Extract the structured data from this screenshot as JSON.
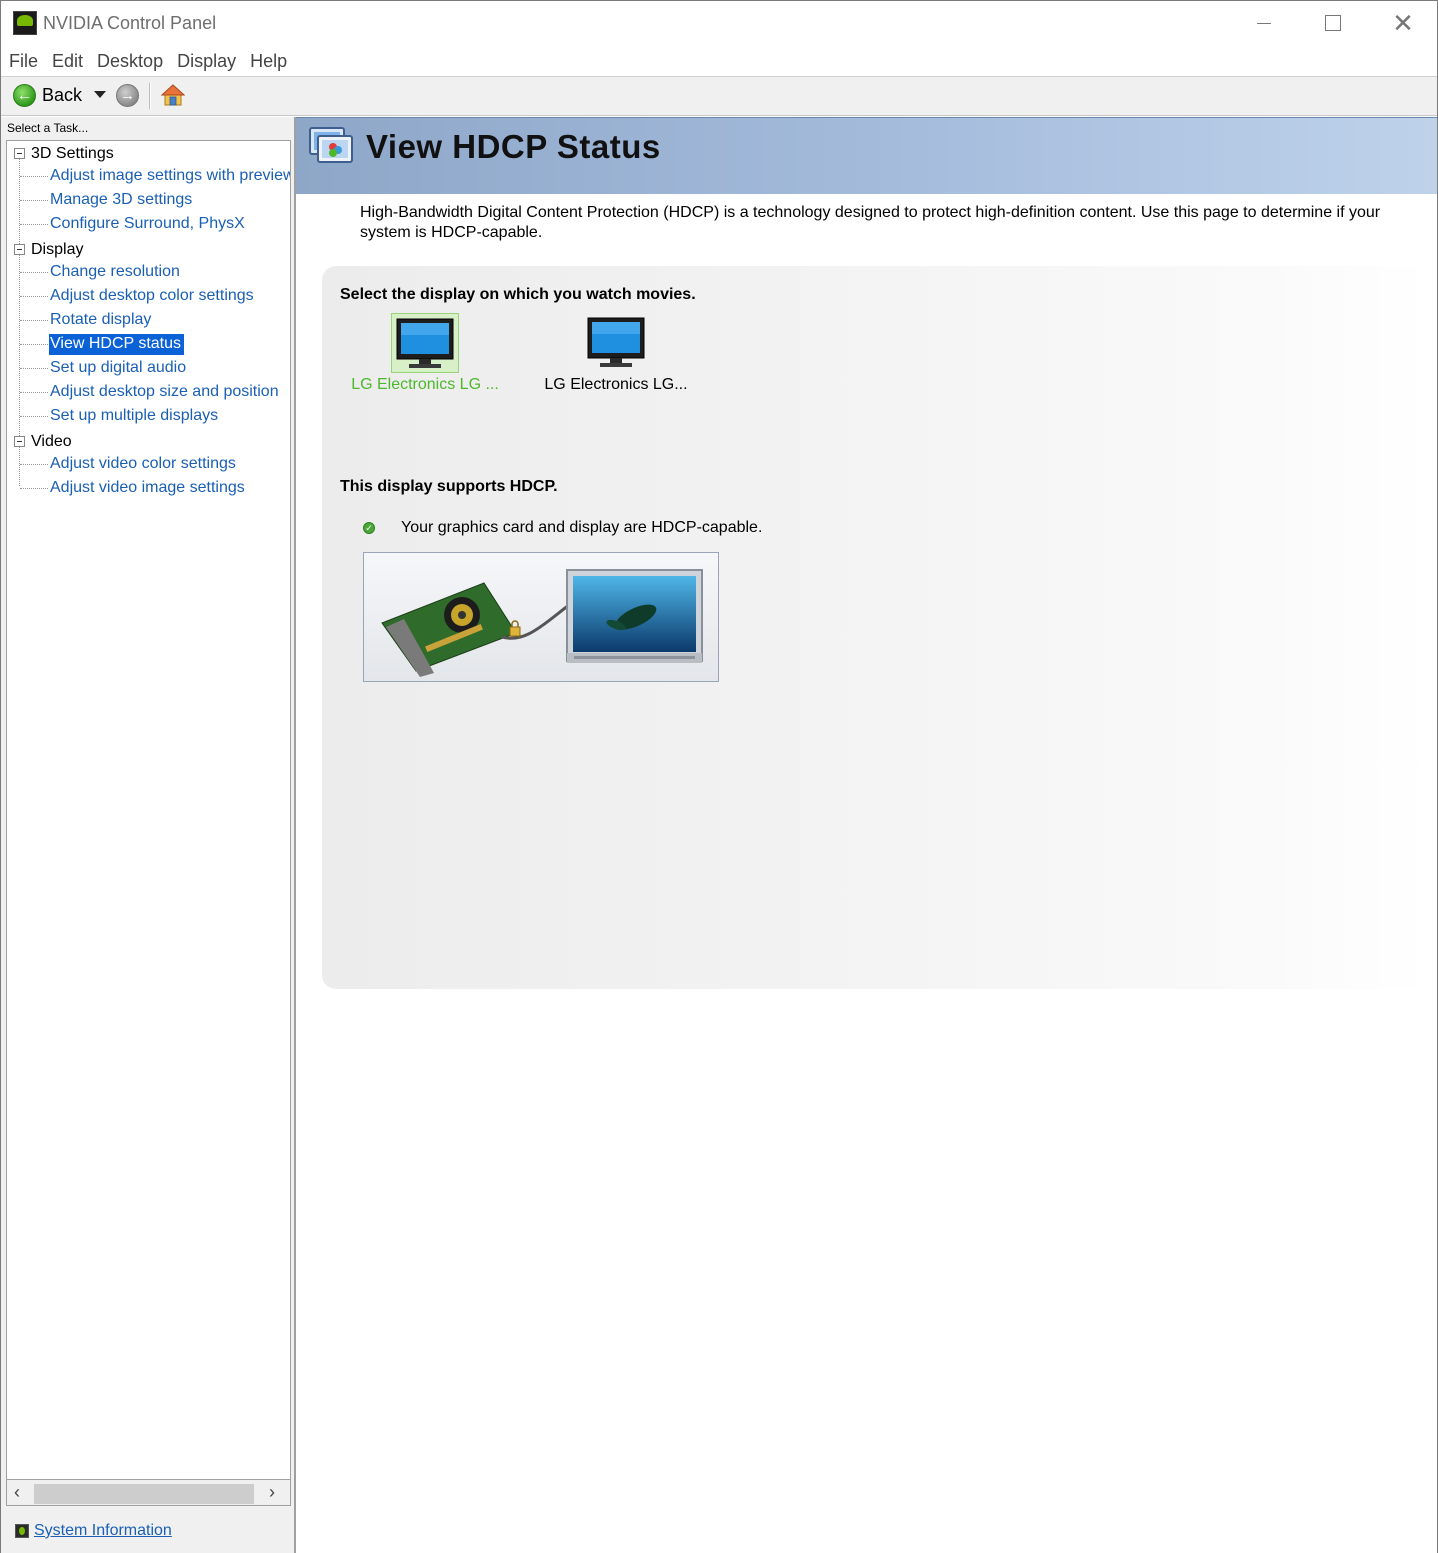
{
  "window": {
    "title": "NVIDIA Control Panel",
    "minimize_icon": "minimize-icon",
    "maximize_icon": "maximize-icon",
    "close_icon": "close-icon"
  },
  "menu": [
    "File",
    "Edit",
    "Desktop",
    "Display",
    "Help"
  ],
  "toolbar": {
    "back_label": "Back",
    "icons": [
      "back-arrow-icon",
      "dropdown-icon",
      "forward-arrow-icon",
      "home-icon"
    ]
  },
  "sidebar": {
    "select_task_label": "Select a Task...",
    "groups": [
      {
        "label": "3D Settings",
        "items": [
          "Adjust image settings with preview",
          "Manage 3D settings",
          "Configure Surround, PhysX"
        ]
      },
      {
        "label": "Display",
        "items": [
          "Change resolution",
          "Adjust desktop color settings",
          "Rotate display",
          "View HDCP status",
          "Set up digital audio",
          "Adjust desktop size and position",
          "Set up multiple displays"
        ]
      },
      {
        "label": "Video",
        "items": [
          "Adjust video color settings",
          "Adjust video image settings"
        ]
      }
    ],
    "selected_item": "View HDCP status",
    "system_info_label": "System Information"
  },
  "page": {
    "title": "View HDCP Status",
    "description": "High-Bandwidth Digital Content Protection (HDCP) is a technology designed to protect high-definition content. Use this page to determine if your system is HDCP-capable.",
    "select_display_heading": "Select the display on which you watch movies.",
    "displays": [
      {
        "label": "LG Electronics LG ...",
        "selected": true
      },
      {
        "label": "LG Electronics LG...",
        "selected": false
      }
    ],
    "status_heading": "This display supports HDCP.",
    "status_message": "Your graphics card and display are HDCP-capable.",
    "colors": {
      "selected_display_text": "#4cb82a",
      "link": "#1a5fb4",
      "selection": "#0a62d6",
      "banner": "#a3badb"
    }
  }
}
